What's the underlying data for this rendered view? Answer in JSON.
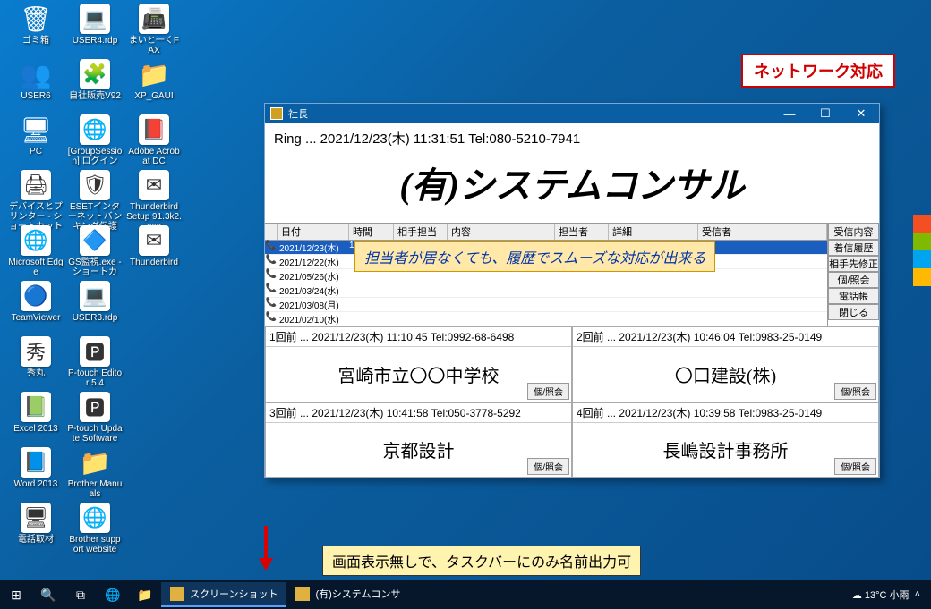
{
  "badge": "ネットワーク対応",
  "desktop_icons": [
    {
      "row": 0,
      "col": 0,
      "label": "ゴミ箱",
      "glyph": "🗑",
      "bg": false
    },
    {
      "row": 0,
      "col": 1,
      "label": "USER4.rdp",
      "glyph": "💻"
    },
    {
      "row": 0,
      "col": 2,
      "label": "まいと一くFAX",
      "glyph": "📠"
    },
    {
      "row": 1,
      "col": 0,
      "label": "USER6",
      "glyph": "👥",
      "bg": false
    },
    {
      "row": 1,
      "col": 1,
      "label": "自社販売V92",
      "glyph": "🧩"
    },
    {
      "row": 1,
      "col": 2,
      "label": "XP_GAUI",
      "glyph": "📁",
      "bg": false
    },
    {
      "row": 2,
      "col": 0,
      "label": "PC",
      "glyph": "🖥",
      "bg": false
    },
    {
      "row": 2,
      "col": 1,
      "label": "[GroupSession] ログイン",
      "glyph": "🌐"
    },
    {
      "row": 2,
      "col": 2,
      "label": "Adobe Acrobat DC",
      "glyph": "📕"
    },
    {
      "row": 3,
      "col": 0,
      "label": "デバイスとプリンター - ショートカット",
      "glyph": "🖨"
    },
    {
      "row": 3,
      "col": 1,
      "label": "ESETインターネットバンキング保護",
      "glyph": "🛡"
    },
    {
      "row": 3,
      "col": 2,
      "label": "Thunderbird Setup 91.3k2.exe",
      "glyph": "✉"
    },
    {
      "row": 4,
      "col": 0,
      "label": "Microsoft Edge",
      "glyph": "🌐"
    },
    {
      "row": 4,
      "col": 1,
      "label": "GS監視.exe - ショートカ",
      "glyph": "🔷"
    },
    {
      "row": 4,
      "col": 2,
      "label": "Thunderbird",
      "glyph": "✉"
    },
    {
      "row": 5,
      "col": 0,
      "label": "TeamViewer",
      "glyph": "🔵"
    },
    {
      "row": 5,
      "col": 1,
      "label": "USER3.rdp",
      "glyph": "💻"
    },
    {
      "row": 6,
      "col": 0,
      "label": "秀丸",
      "glyph": "秀"
    },
    {
      "row": 6,
      "col": 1,
      "label": "P-touch Editor 5.4",
      "glyph": "🅿"
    },
    {
      "row": 7,
      "col": 0,
      "label": "Excel 2013",
      "glyph": "📗"
    },
    {
      "row": 7,
      "col": 1,
      "label": "P-touch Update Software",
      "glyph": "🅿"
    },
    {
      "row": 8,
      "col": 0,
      "label": "Word 2013",
      "glyph": "📘"
    },
    {
      "row": 8,
      "col": 1,
      "label": "Brother Manuals",
      "glyph": "📁",
      "bg": false
    },
    {
      "row": 9,
      "col": 0,
      "label": "電話取材",
      "glyph": "🖥"
    },
    {
      "row": 9,
      "col": 1,
      "label": "Brother support website",
      "glyph": "🌐"
    }
  ],
  "app": {
    "title": "社長",
    "ring_line": "Ring ... 2021/12/23(木) 11:31:51  Tel:080-5210-7941",
    "company": "(有)システムコンサル",
    "hist_cols": {
      "c1": "日付",
      "c2": "時間",
      "c3": "相手担当",
      "c4": "内容",
      "c5": "担当者",
      "c6": "詳細",
      "c7": "受信者"
    },
    "hist_rows": [
      {
        "date": "2021/12/23(木)",
        "time": "11:31:51",
        "sel": true
      },
      {
        "date": "2021/12/22(水)",
        "time": ""
      },
      {
        "date": "2021/05/26(水)",
        "time": ""
      },
      {
        "date": "2021/03/24(水)",
        "time": ""
      },
      {
        "date": "2021/03/08(月)",
        "time": ""
      },
      {
        "date": "2021/02/10(水)",
        "time": ""
      }
    ],
    "hist_note": "担当者が居なくても、履歴でスムーズな対応が出来る",
    "side_buttons": [
      "受信内容",
      "着信履歴",
      "相手先修正",
      "個/照会",
      "電話帳",
      "閉じる"
    ],
    "quads": [
      {
        "head": "1回前 ... 2021/12/23(木) 11:10:45 Tel:0992-68-6498",
        "name": "宮崎市立〇〇中学校"
      },
      {
        "head": "2回前 ... 2021/12/23(木) 10:46:04 Tel:0983-25-0149",
        "name": "〇口建設(株)"
      },
      {
        "head": "3回前 ... 2021/12/23(木) 10:41:58 Tel:050-3778-5292",
        "name": "京都設計"
      },
      {
        "head": "4回前 ... 2021/12/23(木) 10:39:58 Tel:0983-25-0149",
        "name": "長嶋設計事務所"
      }
    ],
    "quad_btn": "個/照会"
  },
  "note2": "画面表示無しで、タスクバーにのみ名前出力可",
  "taskbar": {
    "items": [
      {
        "label": "スクリーンショット",
        "active": true
      },
      {
        "label": "(有)システムコンサ",
        "active": false
      }
    ],
    "weather": "13°C 小雨"
  }
}
